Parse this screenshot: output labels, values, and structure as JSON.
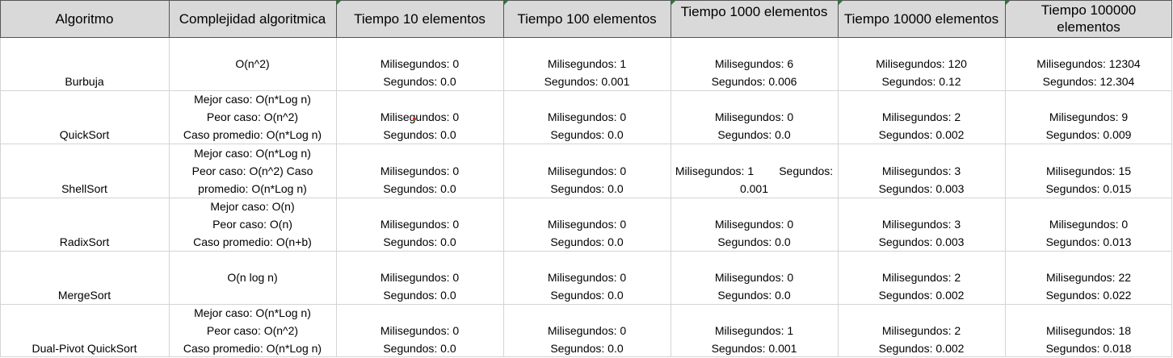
{
  "headers": [
    "Algoritmo",
    "Complejidad algoritmica",
    "Tiempo 10 elementos",
    "Tiempo 100 elementos",
    "Tiempo 1000 elementos",
    "Tiempo 10000 elementos",
    "Tiempo 100000 elementos"
  ],
  "rows": [
    {
      "name": "Burbuja",
      "complexity": [
        "O(n^2)"
      ],
      "times": [
        [
          "Milisegundos: 0",
          "Segundos: 0.0"
        ],
        [
          "Milisegundos: 1",
          "Segundos: 0.001"
        ],
        [
          "Milisegundos: 6",
          "Segundos: 0.006"
        ],
        [
          "Milisegundos: 120",
          "Segundos: 0.12"
        ],
        [
          "Milisegundos: 12304",
          "Segundos: 12.304"
        ]
      ]
    },
    {
      "name": "QuickSort",
      "complexity": [
        "Mejor caso: O(n*Log n)",
        "Peor caso: O(n^2)",
        "Caso promedio: O(n*Log n)"
      ],
      "times": [
        [
          "Milisegundos: 0",
          "Segundos: 0.0"
        ],
        [
          "Milisegundos: 0",
          "Segundos: 0.0"
        ],
        [
          "Milisegundos: 0",
          "Segundos: 0.0"
        ],
        [
          "Milisegundos: 2",
          "Segundos: 0.002"
        ],
        [
          "Milisegundos: 9",
          "Segundos: 0.009"
        ]
      ]
    },
    {
      "name": "ShellSort",
      "complexity": [
        "Mejor caso: O(n*Log n)",
        "Peor caso: O(n^2) Caso",
        "promedio: O(n*Log n)"
      ],
      "times": [
        [
          "Milisegundos: 0",
          "Segundos: 0.0"
        ],
        [
          "Milisegundos: 0",
          "Segundos: 0.0"
        ],
        [
          "Milisegundos: 1        Segundos:",
          "0.001"
        ],
        [
          "Milisegundos: 3",
          "Segundos: 0.003"
        ],
        [
          "Milisegundos: 15",
          "Segundos: 0.015"
        ]
      ]
    },
    {
      "name": "RadixSort",
      "complexity": [
        "Mejor caso: O(n)",
        "Peor caso: O(n)",
        "Caso promedio: O(n+b)"
      ],
      "times": [
        [
          "Milisegundos: 0",
          "Segundos: 0.0"
        ],
        [
          "Milisegundos: 0",
          "Segundos: 0.0"
        ],
        [
          "Milisegundos: 0",
          "Segundos: 0.0"
        ],
        [
          "Milisegundos: 3",
          "Segundos: 0.003"
        ],
        [
          "Milisegundos: 0",
          "Segundos: 0.013"
        ]
      ]
    },
    {
      "name": "MergeSort",
      "complexity": [
        "O(n log n)"
      ],
      "times": [
        [
          "Milisegundos: 0",
          "Segundos: 0.0"
        ],
        [
          "Milisegundos: 0",
          "Segundos: 0.0"
        ],
        [
          "Milisegundos: 0",
          "Segundos: 0.0"
        ],
        [
          "Milisegundos: 2",
          "Segundos: 0.002"
        ],
        [
          "Milisegundos: 22",
          "Segundos: 0.022"
        ]
      ]
    },
    {
      "name": "Dual-Pivot QuickSort",
      "complexity": [
        "Mejor caso: O(n*Log n)",
        "Peor caso: O(n^2)",
        "Caso promedio: O(n*Log n)"
      ],
      "times": [
        [
          "Milisegundos: 0",
          "Segundos: 0.0"
        ],
        [
          "Milisegundos: 0",
          "Segundos: 0.0"
        ],
        [
          "Milisegundos: 1",
          "Segundos: 0.001"
        ],
        [
          "Milisegundos: 2",
          "Segundos: 0.002"
        ],
        [
          "Milisegundos: 18",
          "Segundos: 0.018"
        ]
      ]
    }
  ],
  "colors": {
    "header_bg": "#d9d9d9",
    "grid": "#d4d4d4",
    "header_grid": "#555555",
    "comment_marker": "#1e7d32"
  }
}
